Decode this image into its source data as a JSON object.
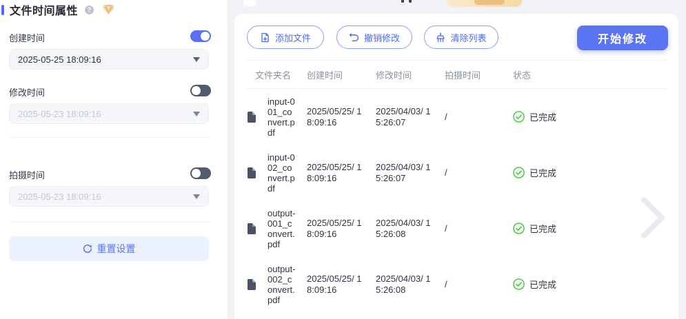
{
  "colors": {
    "accent": "#4d6bfe",
    "primary_button": "#5b74f3",
    "toggle_on": "#5c6ef2",
    "toggle_off": "#515b6e",
    "success": "#43c43f"
  },
  "sidebar": {
    "title": "文件时间属性",
    "fields": [
      {
        "label": "创建时间",
        "enabled": true,
        "value": "2025-05-25 18:09:16"
      },
      {
        "label": "修改时间",
        "enabled": false,
        "value": "2025-05-23 18:09:16"
      },
      {
        "label": "拍摄时间",
        "enabled": false,
        "value": "2025-05-23 18:09:16"
      }
    ],
    "reset_label": "重置设置",
    "help_glyph": "?"
  },
  "toolbar": {
    "add_label": "添加文件",
    "undo_label": "撤销修改",
    "clear_label": "清除列表",
    "start_label": "开始修改"
  },
  "table": {
    "headers": [
      "文件夹名",
      "创建时间",
      "修改时间",
      "拍摄时间",
      "状态"
    ],
    "rows": [
      {
        "name": "input-001_convert.pdf",
        "created": "2025/05/25/ 18:09:16",
        "modified": "2025/04/03/ 15:26:07",
        "shot": "/",
        "status": "已完成"
      },
      {
        "name": "input-002_convert.pdf",
        "created": "2025/05/25/ 18:09:16",
        "modified": "2025/04/03/ 15:26:07",
        "shot": "/",
        "status": "已完成"
      },
      {
        "name": "output-001_convert.pdf",
        "created": "2025/05/25/ 18:09:16",
        "modified": "2025/04/03/ 15:26:08",
        "shot": "/",
        "status": "已完成"
      },
      {
        "name": "output-002_convert.pdf",
        "created": "2025/05/25/ 18:09:16",
        "modified": "2025/04/03/ 15:26:08",
        "shot": "/",
        "status": "已完成"
      }
    ]
  }
}
